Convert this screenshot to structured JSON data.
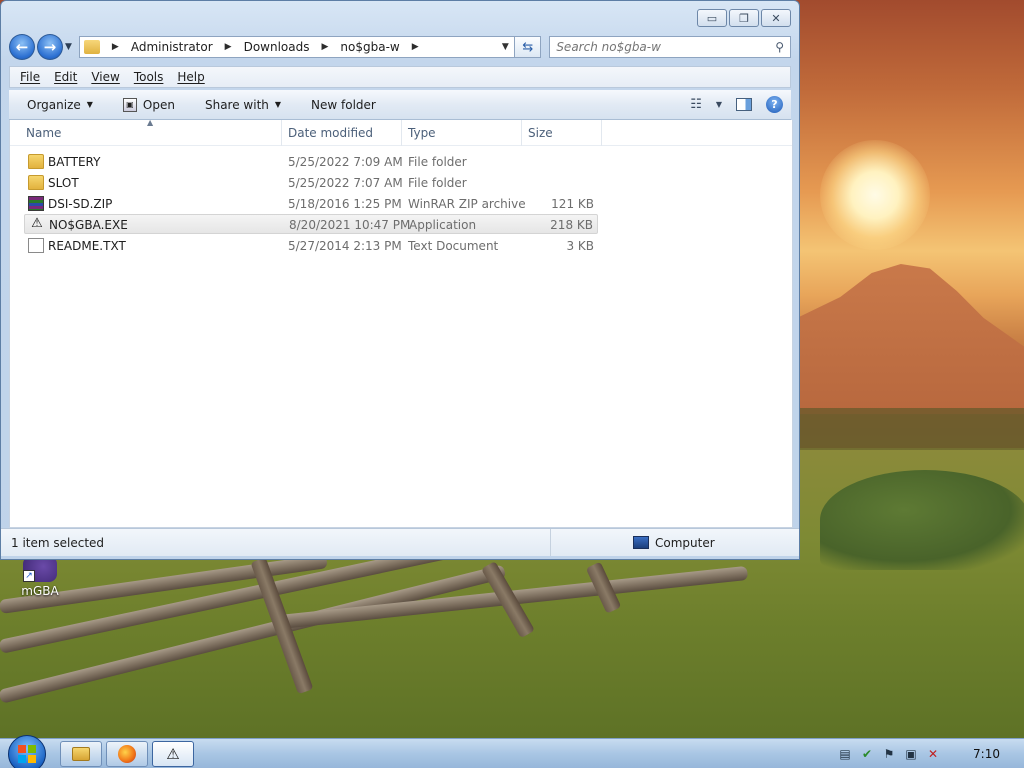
{
  "window": {
    "controls": {
      "minimize": "▭",
      "restore": "❐",
      "close": "✕"
    }
  },
  "address": {
    "crumbs": [
      "Administrator",
      "Downloads",
      "no$gba-w"
    ],
    "search_placeholder": "Search no$gba-w"
  },
  "menu": [
    "File",
    "Edit",
    "View",
    "Tools",
    "Help"
  ],
  "toolbar": {
    "organize": "Organize",
    "open": "Open",
    "share_with": "Share with",
    "new_folder": "New folder"
  },
  "columns": {
    "name": "Name",
    "date_modified": "Date modified",
    "type": "Type",
    "size": "Size"
  },
  "files": [
    {
      "name": "BATTERY",
      "date": "5/25/2022 7:09 AM",
      "type": "File folder",
      "size": "",
      "icon": "folder-icon"
    },
    {
      "name": "SLOT",
      "date": "5/25/2022 7:07 AM",
      "type": "File folder",
      "size": "",
      "icon": "folder-icon"
    },
    {
      "name": "DSI-SD.ZIP",
      "date": "5/18/2016 1:25 PM",
      "type": "WinRAR ZIP archive",
      "size": "121 KB",
      "icon": "zip-archive-icon"
    },
    {
      "name": "NO$GBA.EXE",
      "date": "8/20/2021 10:47 PM",
      "type": "Application",
      "size": "218 KB",
      "icon": "application-icon",
      "selected": true
    },
    {
      "name": "README.TXT",
      "date": "5/27/2014 2:13 PM",
      "type": "Text Document",
      "size": "3 KB",
      "icon": "text-document-icon"
    }
  ],
  "status": {
    "selection": "1 item selected",
    "location": "Computer"
  },
  "desktop": {
    "icon_label": "mGBA"
  },
  "taskbar": {
    "clock": "7:10"
  }
}
